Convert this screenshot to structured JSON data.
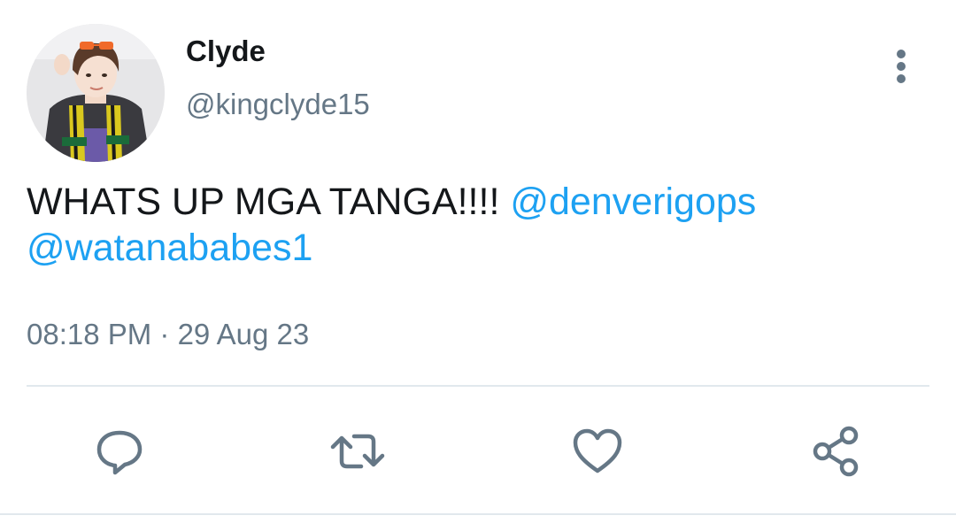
{
  "user": {
    "display_name": "Clyde",
    "handle": "@kingclyde15"
  },
  "tweet": {
    "text": "WHATS UP MGA TANGA!!!! ",
    "mentions": [
      "@denverigops",
      "@watanababes1"
    ],
    "time": "08:18 PM",
    "separator": " · ",
    "date": "29 Aug 23"
  },
  "actions": {
    "reply_icon": "reply-icon",
    "retweet_icon": "retweet-icon",
    "like_icon": "like-icon",
    "share_icon": "share-icon",
    "more_icon": "more-vertical-icon"
  },
  "colors": {
    "mention": "#1da1f2",
    "secondary_text": "#657786",
    "primary_text": "#14171a",
    "icon": "#657786",
    "divider": "#e1e8ed"
  }
}
